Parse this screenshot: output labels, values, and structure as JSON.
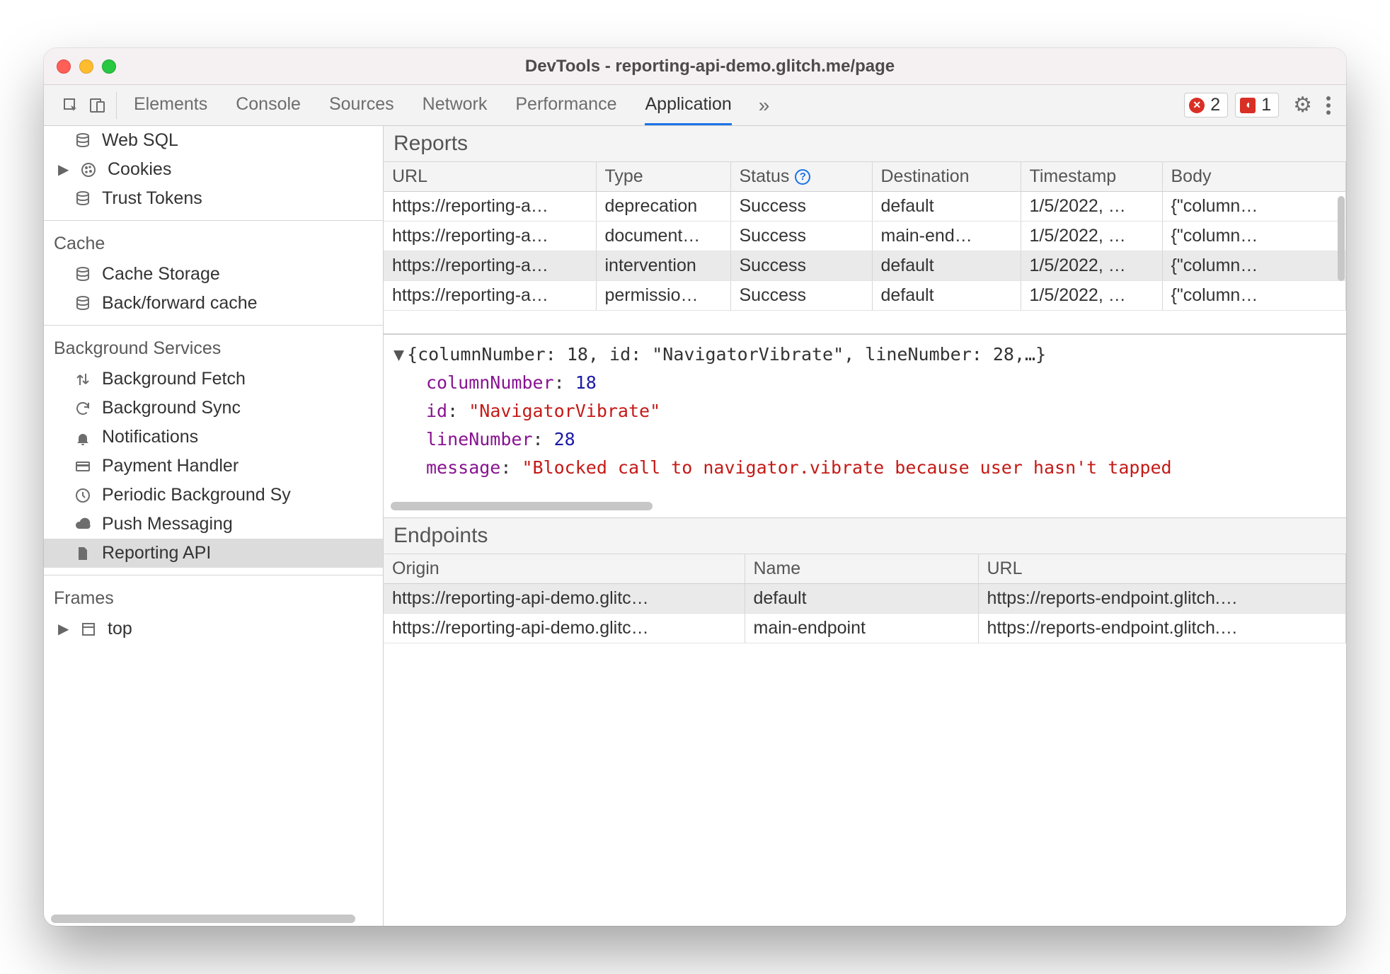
{
  "window": {
    "title": "DevTools - reporting-api-demo.glitch.me/page"
  },
  "toolbar": {
    "tabs": [
      "Elements",
      "Console",
      "Sources",
      "Network",
      "Performance",
      "Application"
    ],
    "active_tab_index": 5,
    "errors_count": "2",
    "issues_count": "1"
  },
  "sidebar": {
    "top_items": [
      {
        "label": "Web SQL",
        "icon": "database"
      },
      {
        "label": "Cookies",
        "icon": "cookie",
        "expandable": true
      },
      {
        "label": "Trust Tokens",
        "icon": "database"
      }
    ],
    "cache_header": "Cache",
    "cache_items": [
      {
        "label": "Cache Storage",
        "icon": "database"
      },
      {
        "label": "Back/forward cache",
        "icon": "database"
      }
    ],
    "bg_header": "Background Services",
    "bg_items": [
      {
        "label": "Background Fetch",
        "icon": "updown"
      },
      {
        "label": "Background Sync",
        "icon": "sync"
      },
      {
        "label": "Notifications",
        "icon": "bell"
      },
      {
        "label": "Payment Handler",
        "icon": "card"
      },
      {
        "label": "Periodic Background Sy",
        "icon": "clock"
      },
      {
        "label": "Push Messaging",
        "icon": "cloud"
      },
      {
        "label": "Reporting API",
        "icon": "file",
        "selected": true
      }
    ],
    "frames_header": "Frames",
    "frames_items": [
      {
        "label": "top",
        "icon": "frame",
        "expandable": true
      }
    ]
  },
  "reports": {
    "title": "Reports",
    "columns": [
      "URL",
      "Type",
      "Status",
      "Destination",
      "Timestamp",
      "Body"
    ],
    "rows": [
      {
        "url": "https://reporting-a…",
        "type": "deprecation",
        "status": "Success",
        "dest": "default",
        "ts": "1/5/2022, …",
        "body": "{\"column…",
        "sel": false
      },
      {
        "url": "https://reporting-a…",
        "type": "document…",
        "status": "Success",
        "dest": "main-end…",
        "ts": "1/5/2022, …",
        "body": "{\"column…",
        "sel": false
      },
      {
        "url": "https://reporting-a…",
        "type": "intervention",
        "status": "Success",
        "dest": "default",
        "ts": "1/5/2022, …",
        "body": "{\"column…",
        "sel": true
      },
      {
        "url": "https://reporting-a…",
        "type": "permissio…",
        "status": "Success",
        "dest": "default",
        "ts": "1/5/2022, …",
        "body": "{\"column…",
        "sel": false
      }
    ]
  },
  "inspector": {
    "summary": "{columnNumber: 18, id: \"NavigatorVibrate\", lineNumber: 28,…}",
    "props": [
      {
        "key": "columnNumber",
        "type": "num",
        "val": "18"
      },
      {
        "key": "id",
        "type": "str",
        "val": "\"NavigatorVibrate\""
      },
      {
        "key": "lineNumber",
        "type": "num",
        "val": "28"
      },
      {
        "key": "message",
        "type": "str",
        "val": "\"Blocked call to navigator.vibrate because user hasn't tapped"
      }
    ]
  },
  "endpoints": {
    "title": "Endpoints",
    "columns": [
      "Origin",
      "Name",
      "URL"
    ],
    "rows": [
      {
        "origin": "https://reporting-api-demo.glitc…",
        "name": "default",
        "url": "https://reports-endpoint.glitch.…",
        "sel": true
      },
      {
        "origin": "https://reporting-api-demo.glitc…",
        "name": "main-endpoint",
        "url": "https://reports-endpoint.glitch.…",
        "sel": false
      }
    ]
  }
}
